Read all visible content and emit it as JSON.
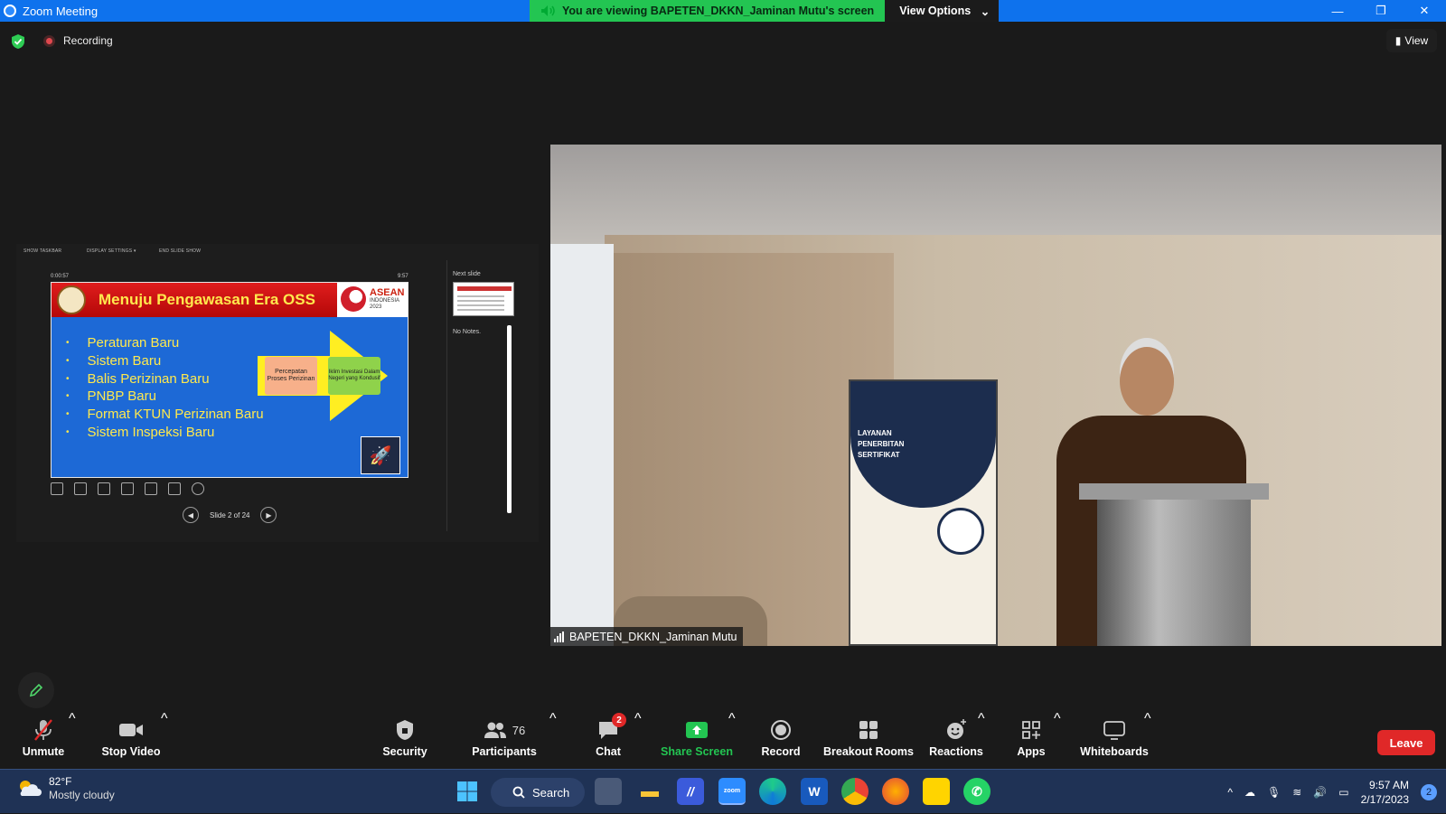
{
  "window": {
    "title": "Zoom Meeting",
    "minimize": "—",
    "restore": "❐",
    "close": "✕"
  },
  "share_banner": {
    "message": "You are viewing BAPETEN_DKKN_Jaminan Mutu's screen",
    "view_options": "View Options"
  },
  "topbar": {
    "recording": "Recording",
    "view": "View"
  },
  "presenter": {
    "tools": [
      "SHOW TASKBAR",
      "DISPLAY SETTINGS ▾",
      "END SLIDE SHOW"
    ],
    "timer": "0:00:57",
    "clock": "9:57",
    "slide_nav": "Slide 2 of 24",
    "next_slide_label": "Next slide",
    "notes": "No Notes."
  },
  "slide": {
    "title": "Menuju Pengawasan Era OSS",
    "asean_title": "ASEAN",
    "asean_sub": "INDONESIA 2023",
    "bullets": [
      "Peraturan Baru",
      "Sistem Baru",
      "Balis Perizinan Baru",
      "PNBP Baru",
      "Format KTUN Perizinan Baru",
      "Sistem Inspeksi Baru"
    ],
    "box1": "Percepatan Proses Perizinan",
    "box2": "Iklim Investasi Dalam Negeri yang Kondusif",
    "banner_text": "LAYANAN PENERBITAN SERTIFIKAT"
  },
  "video": {
    "name": "BAPETEN_DKKN_Jaminan Mutu"
  },
  "toolbar": {
    "unmute": "Unmute",
    "stop_video": "Stop Video",
    "security": "Security",
    "participants": "Participants",
    "participants_count": "76",
    "chat": "Chat",
    "chat_badge": "2",
    "share_screen": "Share Screen",
    "record": "Record",
    "breakout": "Breakout Rooms",
    "reactions": "Reactions",
    "apps": "Apps",
    "whiteboards": "Whiteboards",
    "leave": "Leave"
  },
  "taskbar": {
    "temp": "82°F",
    "weather": "Mostly cloudy",
    "search": "Search",
    "time": "9:57 AM",
    "date": "2/17/2023",
    "notif_count": "2"
  },
  "colors": {
    "zoom_blue": "#0e72ed",
    "share_green": "#23c552",
    "leave_red": "#e02828"
  }
}
